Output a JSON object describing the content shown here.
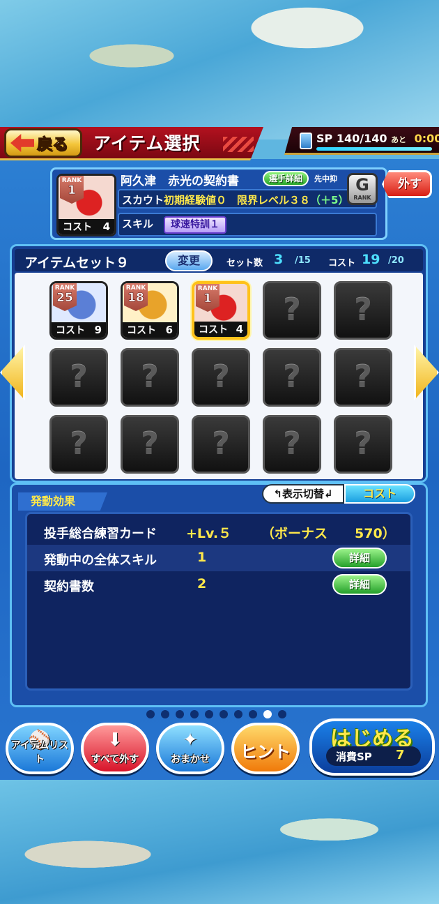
{
  "header": {
    "back_label": "戻る",
    "title": "アイテム選択",
    "sp_label": "SP",
    "sp_value": "140/140",
    "sp_remaining_label": "あと",
    "sp_timer": "0:00",
    "sp_fill_fraction": 1.0
  },
  "selected_item": {
    "rank_label": "RANK",
    "rank": "1",
    "cost_label": "コスト",
    "cost": "4",
    "name": "阿久津　赤光の契約書",
    "detail_tag": "選手詳細",
    "position_tag": "先中抑",
    "scout_label": "スカウト",
    "scout_value": "初期経験値０　限界レベル３８",
    "scout_bonus": "（＋5）",
    "skill_label": "スキル",
    "skill_value": "球速特訓１",
    "grade_icon": "G",
    "grade_label": "RANK",
    "remove_label": "外す"
  },
  "item_set": {
    "title": "アイテムセット９",
    "change_label": "変更",
    "set_count_label": "セット数",
    "set_count": "3",
    "set_count_max": "/15",
    "cost_label": "コスト",
    "cost": "19",
    "cost_max": "/20",
    "filled_slots": [
      {
        "rank_label": "RANK",
        "rank": "25",
        "cost_label": "コスト",
        "cost": "9",
        "icon": "player-portrait-icon"
      },
      {
        "rank_label": "RANK",
        "rank": "18",
        "cost_label": "コスト",
        "cost": "6",
        "icon": "ball-card-icon"
      },
      {
        "rank_label": "RANK",
        "rank": "1",
        "cost_label": "コスト",
        "cost": "4",
        "icon": "contract-icon"
      }
    ],
    "empty_slot_glyph": "?"
  },
  "effects": {
    "tab_label": "発動効果",
    "toggle_label": "表示切替",
    "toggle_value": "コスト",
    "rows": [
      {
        "label": "投手総合練習カード",
        "value": "+Lv.５",
        "bonus_label": "（ボーナス",
        "bonus_value": "570）"
      },
      {
        "label": "発動中の全体スキル",
        "value": "1",
        "detail_label": "詳細"
      },
      {
        "label": "契約書数",
        "value": "2",
        "detail_label": "詳細"
      }
    ]
  },
  "pagination": {
    "total": 10,
    "active_index": 8
  },
  "bottom_buttons": {
    "item_list": "アイテムリスト",
    "remove_all": "すべて外す",
    "auto": "おまかせ",
    "hint": "ヒント",
    "start": "はじめる",
    "start_cost_label": "消費SP",
    "start_cost": "7"
  },
  "colors": {
    "accent_yellow": "#ffe84a",
    "panel_blue": "#1b4ea8",
    "header_red": "#b3111f",
    "cyan_value": "#4ee0ff"
  }
}
